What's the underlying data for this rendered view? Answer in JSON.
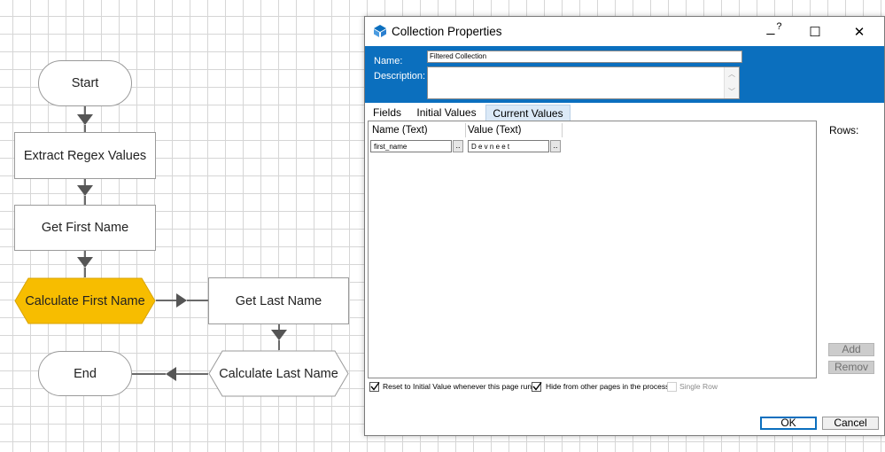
{
  "flowchart": {
    "nodes": {
      "start": "Start",
      "extract": "Extract Regex Values",
      "get_first": "Get First Name",
      "calc_first": "Calculate First Name",
      "get_last": "Get Last Name",
      "calc_last": "Calculate Last Name",
      "end": "End"
    },
    "colors": {
      "highlight": "#f7bd00",
      "node_border": "#9a9a9a",
      "connector": "#6a6a6a"
    }
  },
  "dialog": {
    "title": "Collection Properties",
    "controls": {
      "minimize": "_",
      "help": "?",
      "maximize": "☐",
      "close": "✕"
    },
    "name_label": "Name:",
    "name_value": "Filtered Collection",
    "description_label": "Description:",
    "description_value": "",
    "tabs": [
      "Fields",
      "Initial Values",
      "Current Values"
    ],
    "active_tab": "Current Values",
    "columns": [
      "Name (Text)",
      "Value (Text)"
    ],
    "rows": [
      {
        "name": "first_name",
        "value": "D e v n e e t"
      }
    ],
    "ellipsis": "..",
    "rows_label": "Rows:",
    "add_button": "Add",
    "remove_button": "Remov",
    "checkboxes": {
      "reset": {
        "label": "Reset to Initial Value whenever this page runs",
        "checked": true
      },
      "hide": {
        "label": "Hide from other pages in the process",
        "checked": true
      },
      "single_row": {
        "label": "Single Row",
        "checked": false
      }
    },
    "ok_button": "OK",
    "cancel_button": "Cancel",
    "colors": {
      "header": "#0b6fbe",
      "active_tab": "#dbe9f7"
    }
  }
}
